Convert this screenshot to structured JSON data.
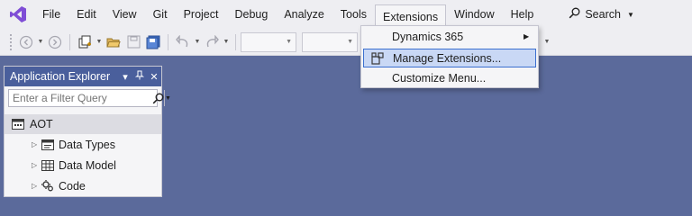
{
  "menu": {
    "items": [
      "File",
      "Edit",
      "View",
      "Git",
      "Project",
      "Debug",
      "Analyze",
      "Tools",
      "Extensions",
      "Window",
      "Help"
    ],
    "active": "Extensions",
    "search_label": "Search"
  },
  "extensions_menu": {
    "items": [
      {
        "label": "Dynamics 365",
        "has_submenu": true
      },
      {
        "label": "Manage Extensions...",
        "icon": "manage-extensions-icon"
      },
      {
        "label": "Customize Menu..."
      }
    ]
  },
  "explorer": {
    "title": "Application Explorer",
    "filter_placeholder": "Enter a Filter Query",
    "root": "AOT",
    "nodes": [
      {
        "label": "Data Types",
        "icon": "data-types-icon"
      },
      {
        "label": "Data Model",
        "icon": "data-model-icon"
      },
      {
        "label": "Code",
        "icon": "code-icon"
      }
    ]
  },
  "colors": {
    "background": "#5b6a9b",
    "title_bar": "#4a5f9c",
    "hover": "#c9d8f5",
    "hover_border": "#3b6fcf",
    "logo": "#7f4dd6"
  }
}
